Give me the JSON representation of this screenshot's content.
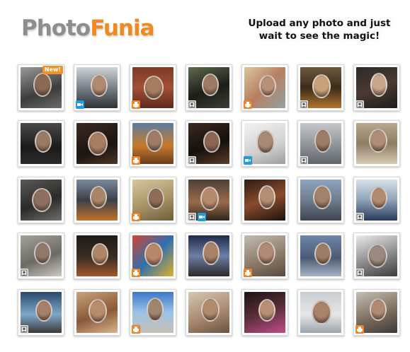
{
  "header": {
    "logo_part1": "Photo",
    "logo_part2": "Funia",
    "tagline_line1": "Upload any photo and just",
    "tagline_line2": "wait to see the magic!"
  },
  "colors": {
    "logo_gray": "#8e8e8e",
    "logo_orange": "#f08a1e",
    "new_badge": "#f39224",
    "print_icon": "#f0842a",
    "video_icon": "#1f9be0",
    "face_icon": "#8a8a8a"
  },
  "gallery": {
    "rows": [
      {
        "tiles": [
          {
            "bg": "linear-gradient(160deg,#9a9a9a,#3c3c3c 60%,#6b6b6b)",
            "face": "#8a6a55",
            "badge": "New!",
            "icons": []
          },
          {
            "bg": "linear-gradient(180deg,#cfd4d8,#707880 55%,#2e3236)",
            "face": "#b08a70",
            "badge": "",
            "icons": [
              "video-icon"
            ]
          },
          {
            "bg": "linear-gradient(180deg,#7d3b28,#a34f33 50%,#5c2a1e)",
            "face": "#a67b60",
            "badge": "",
            "icons": [
              "print-icon"
            ]
          },
          {
            "bg": "linear-gradient(160deg,#5e6a4e,#1c1e18 55%,#3a3f32)",
            "face": "#9d7a62",
            "badge": "",
            "icons": [
              "face-icon"
            ]
          },
          {
            "bg": "linear-gradient(135deg,#d9c79a,#b87f64 50%,#8fa3a0)",
            "face": "#b79177",
            "badge": "",
            "icons": [
              "print-icon"
            ]
          },
          {
            "bg": "linear-gradient(180deg,#6f5a3e,#3a2b1b 50%,#b0742c)",
            "face": "#caa07a",
            "badge": "",
            "icons": [
              "face-icon"
            ]
          },
          {
            "bg": "linear-gradient(160deg,#2b2b2b,#4a3a30 50%,#1d1d1d)",
            "face": "#c9a58c",
            "badge": "",
            "icons": [
              "face-icon"
            ]
          }
        ]
      },
      {
        "tiles": [
          {
            "bg": "linear-gradient(180deg,#4a4a4a,#1a1a1a 60%,#2c2c2c)",
            "face": "#9b7a64",
            "badge": "",
            "icons": []
          },
          {
            "bg": "linear-gradient(160deg,#3a2a20,#1b1410 60%,#4d3626)",
            "face": "#a87d62",
            "badge": "",
            "icons": []
          },
          {
            "bg": "linear-gradient(180deg,#5a7da0,#c77a2c 55%,#6b3d1c)",
            "face": "#9e7b62",
            "badge": "",
            "icons": [
              "print-icon"
            ]
          },
          {
            "bg": "linear-gradient(160deg,#3b2a1f,#14100c 55%,#5a3d28)",
            "face": "#8a6650",
            "badge": "",
            "icons": [
              "face-icon"
            ]
          },
          {
            "bg": "linear-gradient(160deg,#f2f2f2,#d0d0d0 60%,#9c9c9c)",
            "face": "#a88a74",
            "badge": "",
            "icons": [
              "video-icon"
            ]
          },
          {
            "bg": "linear-gradient(180deg,#c4c8cc,#8d9399 55%,#5f656b)",
            "face": "#9d7c66",
            "badge": "",
            "icons": [
              "face-icon"
            ]
          },
          {
            "bg": "linear-gradient(180deg,#b8a98e,#8c7d64 50%,#d7cbb4)",
            "face": "#b08d74",
            "badge": "",
            "icons": []
          }
        ]
      },
      {
        "tiles": [
          {
            "bg": "linear-gradient(160deg,#5a5a58,#2a2a28 55%,#6f6f6b)",
            "face": "#8d6f5d",
            "badge": "",
            "icons": []
          },
          {
            "bg": "linear-gradient(180deg,#7a8a9a,#3a4048 50%,#c2702a)",
            "face": "#a98569",
            "badge": "",
            "icons": []
          },
          {
            "bg": "linear-gradient(160deg,#d8c79c,#a89265 55%,#6e5c3a)",
            "face": "#8e6c55",
            "badge": "",
            "icons": [
              "print-icon"
            ]
          },
          {
            "bg": "linear-gradient(180deg,#4d4038,#9a6a4a 55%,#2e261f)",
            "face": "#b88a6c",
            "badge": "",
            "icons": [
              "face-icon",
              "video-icon"
            ]
          },
          {
            "bg": "linear-gradient(160deg,#2c1d16,#8a4a2c 50%,#1a120e)",
            "face": "#b58d73",
            "badge": "",
            "icons": []
          },
          {
            "bg": "linear-gradient(180deg,#8ea6c0,#6a7888 55%,#3d4550)",
            "face": "#a3826a",
            "badge": "",
            "icons": []
          },
          {
            "bg": "linear-gradient(180deg,#d9e2ea,#8fa2b8 50%,#2a3a5a)",
            "face": "#b38b70",
            "badge": "",
            "icons": [
              "face-icon"
            ]
          }
        ]
      },
      {
        "tiles": [
          {
            "bg": "linear-gradient(160deg,#a5a29a,#6c6a64 55%,#cfcbc2)",
            "face": "#8f7a6a",
            "badge": "",
            "icons": [
              "face-icon"
            ]
          },
          {
            "bg": "linear-gradient(180deg,#1e1a18,#3b2e24 55%,#a3582a)",
            "face": "#b08567",
            "badge": "",
            "icons": []
          },
          {
            "bg": "linear-gradient(135deg,#d6432e,#2e6fb0 50%,#e0b22a)",
            "face": "#b8876a",
            "badge": "",
            "icons": [
              "print-icon"
            ]
          },
          {
            "bg": "linear-gradient(180deg,#1f2a4a,#6e7ea6 50%,#2a2a2a)",
            "face": "#a88268",
            "badge": "",
            "icons": []
          },
          {
            "bg": "linear-gradient(160deg,#c3bcb2,#8d7c6a 55%,#5a4a3c)",
            "face": "#b08a72",
            "badge": "",
            "icons": [
              "print-icon"
            ]
          },
          {
            "bg": "linear-gradient(180deg,#6f86a8,#4a5b76 55%,#a7b3c4)",
            "face": "#9e7d66",
            "badge": "",
            "icons": []
          },
          {
            "bg": "linear-gradient(160deg,#eaeaea,#8a8a8a 55%,#3c3c3c)",
            "face": "#9a8a80",
            "badge": "",
            "icons": [
              "face-icon"
            ]
          }
        ]
      },
      {
        "tiles": [
          {
            "bg": "linear-gradient(180deg,#2c4a6a,#7ea8c8 55%,#3a3a3a)",
            "face": "#a48068",
            "badge": "",
            "icons": [
              "face-icon"
            ]
          },
          {
            "bg": "linear-gradient(160deg,#c9a27a,#8a5a38 55%,#d9b58e)",
            "face": "#b98d6c",
            "badge": "",
            "icons": []
          },
          {
            "bg": "linear-gradient(180deg,#3a78c8,#9cc2e8 50%,#c8c0b0)",
            "face": "#a08570",
            "badge": "",
            "icons": [
              "print-icon"
            ]
          },
          {
            "bg": "linear-gradient(160deg,#d7c7b4,#a88a70 55%,#6a5240)",
            "face": "#b28b6e",
            "badge": "",
            "icons": []
          },
          {
            "bg": "linear-gradient(160deg,#1c1412,#5a2e3a 50%,#c24c8a)",
            "face": "#b88f74",
            "badge": "",
            "icons": []
          },
          {
            "bg": "linear-gradient(180deg,#c8cdd2,#e6e6e6 55%,#9aa4ae)",
            "face": "#a9836a",
            "badge": "",
            "icons": []
          },
          {
            "bg": "linear-gradient(160deg,#c6bfb4,#7d6e60 55%,#3c3a38)",
            "face": "#b08b72",
            "badge": "",
            "icons": [
              "print-icon"
            ]
          }
        ]
      }
    ]
  }
}
